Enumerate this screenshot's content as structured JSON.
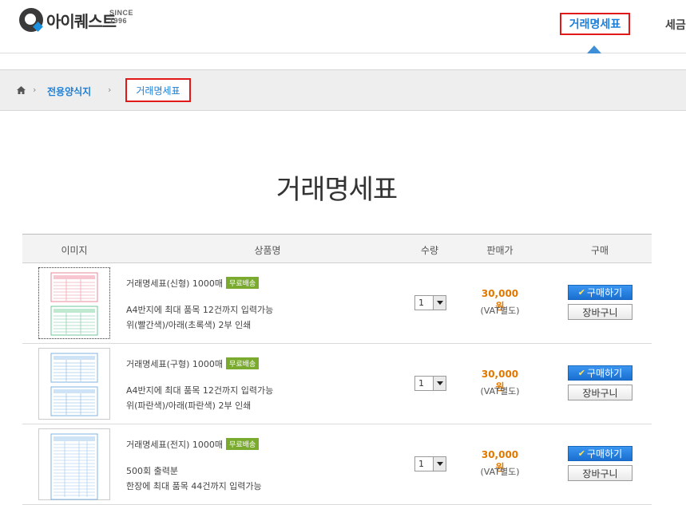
{
  "header": {
    "logo_text": "아이퀘스트",
    "logo_since": "SINCE 1996",
    "nav_active": "거래명세표",
    "nav_next": "세금"
  },
  "breadcrumb": {
    "level1": "전용양식지",
    "level2": "거래명세표"
  },
  "page_title": "거래명세표",
  "table": {
    "columns": [
      "이미지",
      "상품명",
      "수량",
      "판매가",
      "구매"
    ],
    "rows": [
      {
        "name": "거래명세표(신형) 1000매",
        "badge": "무료배송",
        "desc1": "A4반지에 최대 품목 12건까지 입력가능",
        "desc2": "위(빨간색)/아래(초록색) 2부 인쇄",
        "qty": "1",
        "price": "30,000원",
        "vat": "(VAT별도)",
        "buy": "구매하기",
        "cart": "장바구니"
      },
      {
        "name": "거래명세표(구형) 1000매",
        "badge": "무료배송",
        "desc1": "A4반지에 최대 품목 12건까지 입력가능",
        "desc2": "위(파란색)/아래(파란색) 2부 인쇄",
        "qty": "1",
        "price": "30,000원",
        "vat": "(VAT별도)",
        "buy": "구매하기",
        "cart": "장바구니"
      },
      {
        "name": "거래명세표(전지) 1000매",
        "badge": "무료배송",
        "desc1": "500회 출력분",
        "desc2": "한장에 최대 품목 44건까지 입력가능",
        "qty": "1",
        "price": "30,000원",
        "vat": "(VAT별도)",
        "buy": "구매하기",
        "cart": "장바구니"
      }
    ]
  },
  "colors": {
    "accent_blue": "#1e7fd6",
    "highlight_red": "#e01818",
    "price_orange": "#e07800",
    "badge_green": "#7aab2f"
  }
}
